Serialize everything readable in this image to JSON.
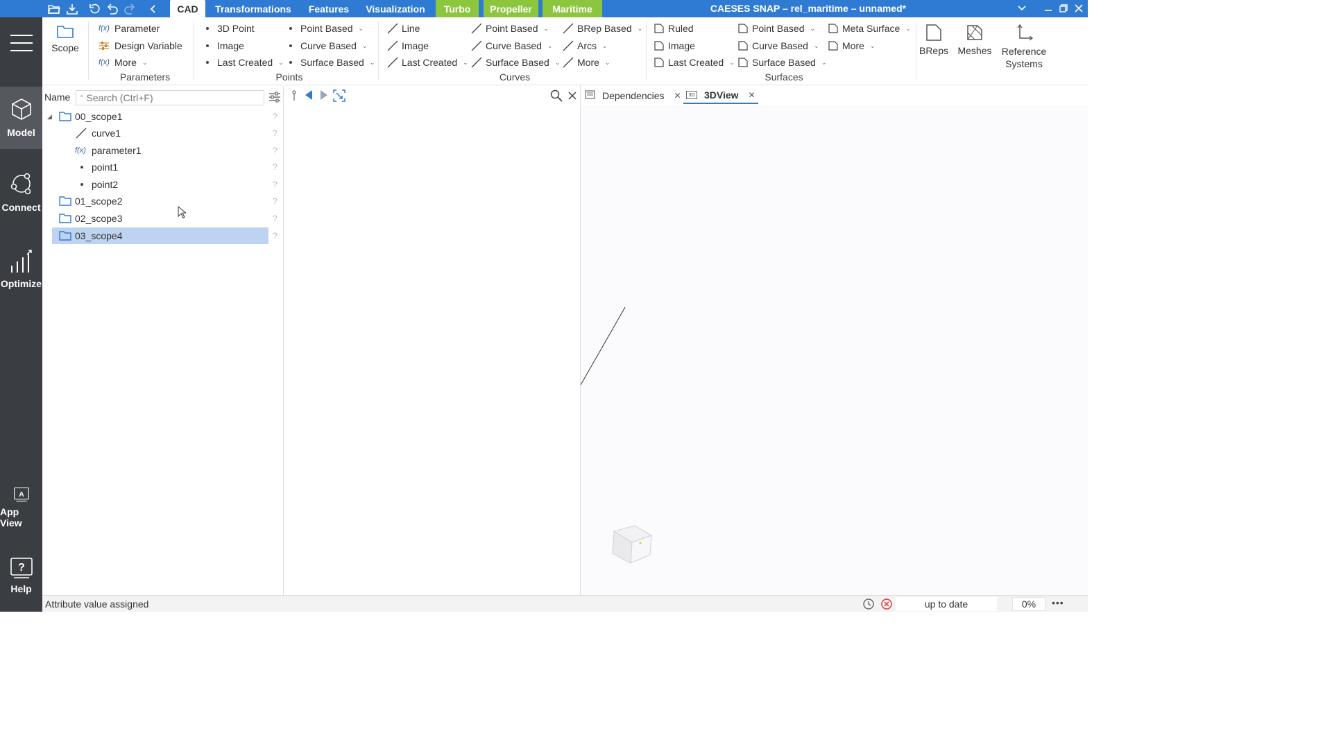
{
  "app": {
    "window_title": "CAESES SNAP – rel_maritime – unnamed*"
  },
  "tabs": [
    {
      "label": "CAD"
    },
    {
      "label": "Transformations"
    },
    {
      "label": "Features"
    },
    {
      "label": "Visualization"
    },
    {
      "label": "Turbo"
    },
    {
      "label": "Propeller"
    },
    {
      "label": "Maritime"
    }
  ],
  "accent_colors": {
    "titlebar": "#2f7bd3",
    "green_tabs": "#8cc63f",
    "selection": "#bed3ef",
    "nav": "#3a3d42"
  },
  "ribbon": {
    "scope": "Scope",
    "parameters": {
      "label": "Parameters",
      "items": [
        "Parameter",
        "Design Variable",
        "More"
      ]
    },
    "points": {
      "label": "Points",
      "col1": [
        "3D Point",
        "Image",
        "Last Created"
      ],
      "col2": [
        "Point Based",
        "Curve Based",
        "Surface Based"
      ]
    },
    "curves": {
      "label": "Curves",
      "col1": [
        "Line",
        "Image",
        "Last Created"
      ],
      "col2": [
        "Point Based",
        "Curve Based",
        "Surface Based"
      ],
      "col3": [
        "BRep Based",
        "Arcs",
        "More"
      ]
    },
    "surfaces": {
      "label": "Surfaces",
      "col1": [
        "Ruled",
        "Image",
        "Last Created"
      ],
      "col2": [
        "Point Based",
        "Curve Based",
        "Surface Based"
      ],
      "col3": [
        "Meta Surface",
        "More"
      ]
    },
    "breps": "BReps",
    "meshes": "Meshes",
    "reference_systems": [
      "Reference",
      "Systems"
    ]
  },
  "nav": {
    "model": "Model",
    "connect": "Connect",
    "optimize": "Optimize",
    "app_view": "App View",
    "help": "Help"
  },
  "tree": {
    "name_header": "Name",
    "search_placeholder": "Search (Ctrl+F)",
    "items": [
      "00_scope1",
      "curve1",
      "parameter1",
      "point1",
      "point2",
      "01_scope2",
      "02_scope3",
      "03_scope4"
    ],
    "fx_label": "f(x)",
    "selected": "03_scope4"
  },
  "view_tabs": {
    "dependencies": "Dependencies",
    "view3d": "3DView",
    "view3d_icon": "3D"
  },
  "status": {
    "message": "Attribute value assigned",
    "state": "up to date",
    "progress": "0%",
    "progress_value": 0
  }
}
